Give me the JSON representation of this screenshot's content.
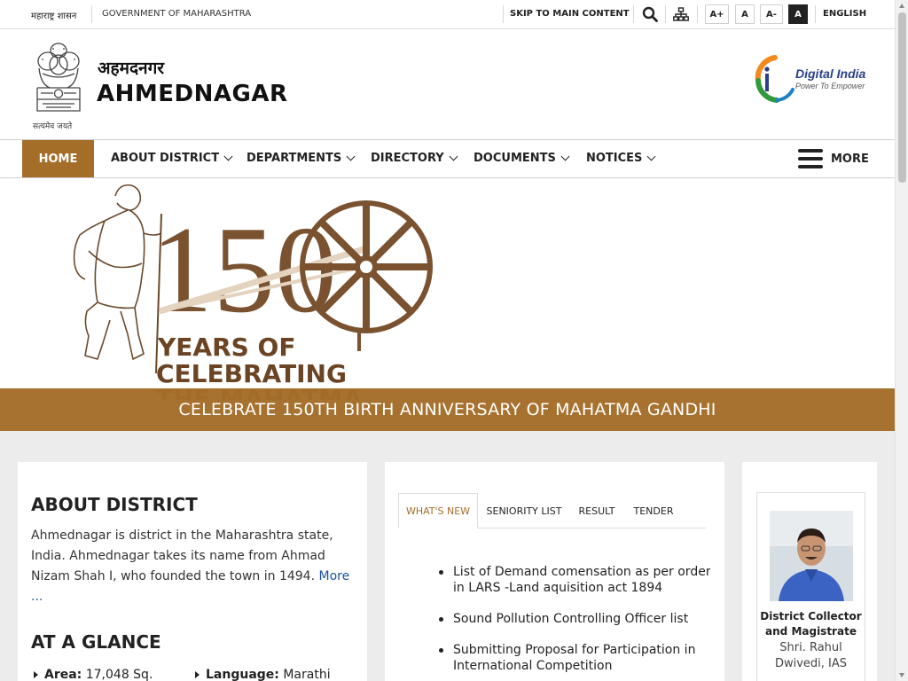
{
  "topbar": {
    "gov_marathi": "महाराष्ट्र शासन",
    "gov_english": "GOVERNMENT OF MAHARASHTRA",
    "skip_link": "SKIP TO MAIN CONTENT",
    "search_icon": "search-icon",
    "sitemap_icon": "sitemap-icon",
    "font_increase": "A+",
    "font_normal": "A",
    "font_decrease": "A-",
    "high_contrast": "A",
    "language": "ENGLISH"
  },
  "header": {
    "emblem_motto": "सत्यमेव जयते",
    "title_marathi": "अहमदनगर",
    "title_english": "AHMEDNAGAR",
    "partner_logo_title": "Digital India",
    "partner_logo_tagline": "Power To Empower"
  },
  "nav": {
    "home": "HOME",
    "items": [
      "ABOUT DISTRICT",
      "DEPARTMENTS",
      "DIRECTORY",
      "DOCUMENTS",
      "NOTICES"
    ],
    "more": "MORE"
  },
  "banner": {
    "number": "150",
    "line1": "YEARS OF",
    "line2": "CELEBRATING",
    "line3": "THE MAHATMA",
    "caption": "CELEBRATE 150TH BIRTH ANNIVERSARY OF MAHATMA GANDHI"
  },
  "about": {
    "heading": "ABOUT DISTRICT",
    "text": "Ahmednagar is district in the Maharashtra state, India. Ahmednagar takes its name from Ahmad Nizam Shah I, who founded the town in 1494.",
    "more_link": "More ..."
  },
  "glance": {
    "heading": "AT A GLANCE",
    "area_label": "Area:",
    "area_value": "17,048 Sq.",
    "language_label": "Language:",
    "language_value": "Marathi"
  },
  "tabs": {
    "items": [
      "WHAT'S NEW",
      "SENIORITY LIST",
      "RESULT",
      "TENDER"
    ],
    "active": "WHAT'S NEW"
  },
  "news": [
    "List of Demand comensation as per order in LARS -Land aquisition act 1894",
    "Sound Pollution Controlling Officer list",
    "Submitting Proposal for Participation in International Competition"
  ],
  "collector": {
    "role": "District Collector and Magistrate",
    "name": "Shri. Rahul Dwivedi, IAS"
  },
  "colors": {
    "accent": "#a46d28",
    "link": "#1a53a0",
    "dark": "#222222"
  }
}
